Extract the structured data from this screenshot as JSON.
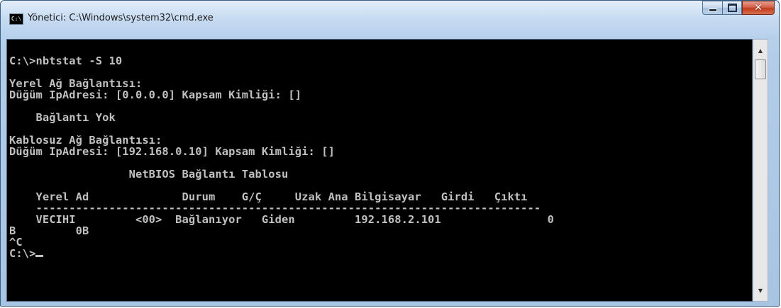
{
  "window": {
    "title": "Yönetici: C:\\Windows\\system32\\cmd.exe",
    "icon_label": "C:\\"
  },
  "controls": {
    "minimize_icon": "minimize-icon",
    "maximize_icon": "maximize-icon",
    "close_glyph": "✕"
  },
  "console": {
    "lines": [
      "",
      "C:\\>nbtstat -S 10",
      "",
      "Yerel Ağ Bağlantısı:",
      "Düğüm IpAdresi: [0.0.0.0] Kapsam Kimliği: []",
      "",
      "    Bağlantı Yok",
      "",
      "Kablosuz Ağ Bağlantısı:",
      "Düğüm IpAdresi: [192.168.0.10] Kapsam Kimliği: []",
      "",
      "                  NetBIOS Bağlantı Tablosu",
      "",
      "    Yerel Ad              Durum    G/Ç     Uzak Ana Bilgisayar   Girdi   Çıktı",
      "    ----------------------------------------------------------------------------",
      "    VECIHI         <00>  Bağlanıyor   Giden         192.168.2.101                0",
      "B         0B",
      "^C",
      "C:\\>"
    ]
  },
  "scrollbar": {
    "up_arrow": "▲",
    "down_arrow": "▼"
  }
}
